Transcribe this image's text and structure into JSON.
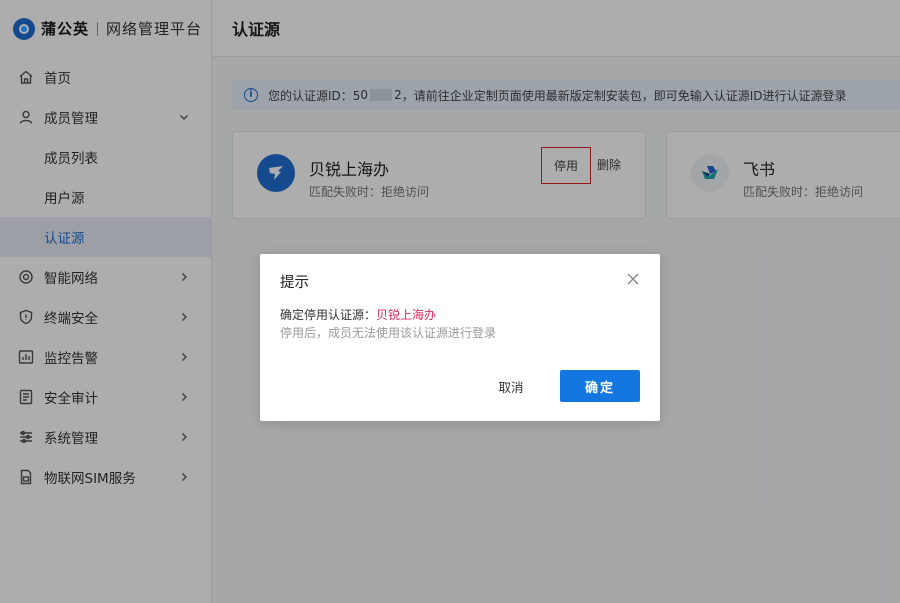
{
  "brand": {
    "name": "蒲公英",
    "subtitle": "网络管理平台"
  },
  "sidebar": {
    "items": [
      {
        "label": "首页",
        "icon": "home-icon"
      },
      {
        "label": "成员管理",
        "icon": "user-icon",
        "expanded": true
      },
      {
        "label": "成员列表"
      },
      {
        "label": "用户源"
      },
      {
        "label": "认证源",
        "active": true
      },
      {
        "label": "智能网络",
        "icon": "network-icon"
      },
      {
        "label": "终端安全",
        "icon": "shield-icon"
      },
      {
        "label": "监控告警",
        "icon": "monitor-icon"
      },
      {
        "label": "安全审计",
        "icon": "audit-icon"
      },
      {
        "label": "系统管理",
        "icon": "settings-icon"
      },
      {
        "label": "物联网SIM服务",
        "icon": "sim-icon"
      }
    ]
  },
  "header": {
    "title": "认证源"
  },
  "notice": {
    "prefix": "您的认证源ID：5",
    "id_start": "0",
    "id_end": "2",
    "text": "，请前往企业定制页面使用最新版定制安装包，即可免输入认证源ID进行认证源登录"
  },
  "cards": [
    {
      "title": "贝锐上海办",
      "subtitle": "匹配失败时：拒绝访问",
      "disable_label": "停用",
      "delete_label": "删除",
      "icon": "dingtalk-icon"
    },
    {
      "title": "飞书",
      "subtitle": "匹配失败时：拒绝访问",
      "icon": "feishu-icon"
    }
  ],
  "dialog": {
    "title": "提示",
    "message_prefix": "确定停用认证源：",
    "message_target": "贝锐上海办",
    "hint": "停用后，成员无法使用该认证源进行登录",
    "cancel_label": "取消",
    "ok_label": "确定"
  },
  "colors": {
    "primary": "#1476e0",
    "highlight": "#e0285a",
    "danger_border": "#e02020"
  }
}
